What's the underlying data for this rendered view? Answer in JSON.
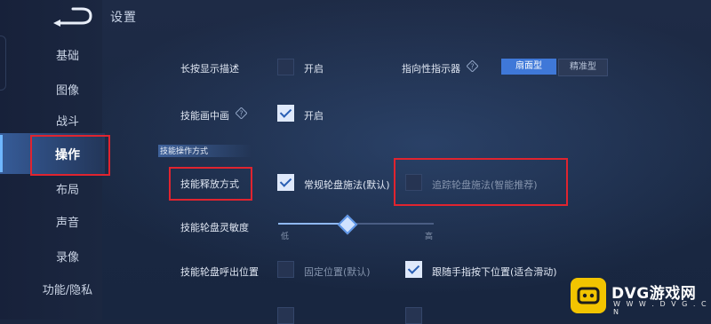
{
  "header": {
    "title": "设置"
  },
  "sidebar": {
    "items": [
      {
        "label": "基础"
      },
      {
        "label": "图像"
      },
      {
        "label": "战斗"
      },
      {
        "label": "操作",
        "active": true
      },
      {
        "label": "布局"
      },
      {
        "label": "声音"
      },
      {
        "label": "录像"
      },
      {
        "label": "功能/隐私"
      }
    ]
  },
  "settings": {
    "long_press": {
      "label": "长按显示描述",
      "toggle_label": "开启",
      "checked": false
    },
    "indicator": {
      "label": "指向性指示器",
      "options": [
        {
          "label": "扇面型",
          "active": true
        },
        {
          "label": "精准型",
          "active": false
        }
      ]
    },
    "pip": {
      "label": "技能画中画",
      "toggle_label": "开启",
      "checked": true
    },
    "section_title": "技能操作方式",
    "release_mode": {
      "label": "技能释放方式",
      "option_a": {
        "label": "常规轮盘施法(默认)",
        "checked": true
      },
      "option_b": {
        "label": "追踪轮盘施法(智能推荐)",
        "checked": false
      }
    },
    "sensitivity": {
      "label": "技能轮盘灵敏度",
      "low": "低",
      "high": "高",
      "value": 0.44
    },
    "wheel_position": {
      "label": "技能轮盘呼出位置",
      "option_a": {
        "label": "固定位置(默认)",
        "checked": false
      },
      "option_b": {
        "label": "跟随手指按下位置(适合滑动)",
        "checked": true
      }
    }
  },
  "watermark": {
    "brand": "DVG游戏网",
    "url": "W W W . D V G . C N"
  },
  "colors": {
    "accent": "#3f78d8",
    "highlight_box": "#e0242f",
    "background": "#1b2740"
  }
}
